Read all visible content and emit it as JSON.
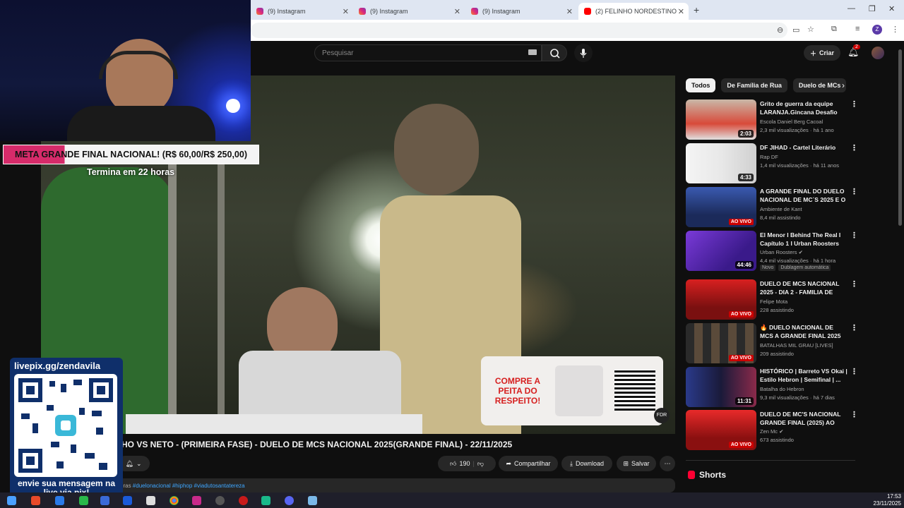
{
  "browser": {
    "tabs": [
      {
        "label": "(9) Instagram",
        "type": "instagram"
      },
      {
        "label": "(9) Instagram",
        "type": "instagram"
      },
      {
        "label": "(9) Instagram",
        "type": "instagram"
      },
      {
        "label": "(2) FELINHO NORDESTINO VS N",
        "type": "youtube"
      }
    ],
    "new_tab_label": "+",
    "profile_initial": "Z"
  },
  "youtube": {
    "search_placeholder": "Pesquisar",
    "create_label": "Criar",
    "notification_count": "2",
    "video_title": "HO VS NETO - (PRIMEIRA FASE) - DUELO DE MCS NACIONAL 2025(GRANDE FINAL) - 22/11/2025",
    "actions": {
      "like_count": "190",
      "share": "Compartilhar",
      "download": "Download",
      "save": "Salvar"
    },
    "description": {
      "prefix": "oras",
      "tags": "#duelonacional #hiphop #viadutosantatereza"
    },
    "promo": {
      "text": "COMPRE A PEITA DO RESPEITO!",
      "logo": "FDR"
    },
    "chips": [
      "Todos",
      "De Família de Rua",
      "Duelo de MCs"
    ],
    "recommendations": [
      {
        "title": "Grito de guerra da equipe LARANJA.Gincana Desafio ED...",
        "channel": "Escola Daniel Berg Cacoal",
        "meta": "2,3 mil visualizações · há 1 ano",
        "duration": "2:03",
        "live": false
      },
      {
        "title": "DF JIHAD - Cartel Literário",
        "channel": "Rap DF",
        "meta": "1,4 mil visualizações · há 11 anos",
        "duration": "4:33",
        "live": false
      },
      {
        "title": "A GRANDE FINAL DO DUELO NACIONAL DE MC´S 2025 E O ...",
        "channel": "Ambiente de Kant",
        "meta": "8,4 mil assistindo",
        "duration": "AO VIVO",
        "live": true
      },
      {
        "title": "El Menor I Behind The Real I Capítulo 1 I Urban Roosters",
        "channel": "Urban Roosters",
        "meta": "4,4 mil visualizações · há 1 hora",
        "duration": "44:46",
        "live": false,
        "badges": [
          "Novo",
          "Dublagem automática"
        ]
      },
      {
        "title": "DUELO DE MCS NACIONAL 2025 - DIA 2 - FAMILIA DE RU...",
        "channel": "Felipe Mota",
        "meta": "228 assistindo",
        "duration": "AO VIVO",
        "live": true
      },
      {
        "title": "🔥 DUELO NACIONAL DE MCS A GRANDE FINAL 2025 AO VIVO...",
        "channel": "BATALHAS MIL GRAU [LIVES]",
        "meta": "209 assistindo",
        "duration": "AO VIVO",
        "live": true
      },
      {
        "title": "HISTÓRICO | Barreto VS Okai | Estilo Hebron | Semifinal | ...",
        "channel": "Batalha do Hebron",
        "meta": "9,3 mil visualizações · há 7 dias",
        "duration": "11:31",
        "live": false
      },
      {
        "title": "DUELO DE MC'S NACIONAL GRANDE FINAL (2025) AO VIV...",
        "channel": "Zen Mc",
        "meta": "673 assistindo",
        "duration": "AO VIVO",
        "live": true
      }
    ],
    "shorts_label": "Shorts"
  },
  "overlay": {
    "goal_text": "META GRANDE FINAL NACIONAL! (R$ 60,00/R$ 250,00)",
    "goal_progress_percent": 24,
    "goal_sub": "Termina em 22 horas",
    "pix_url": "livepix.gg/zendavila",
    "pix_msg": "envie sua mensagem na live via pix!"
  },
  "taskbar": {
    "time": "17:53",
    "date": "23/11/2025"
  }
}
